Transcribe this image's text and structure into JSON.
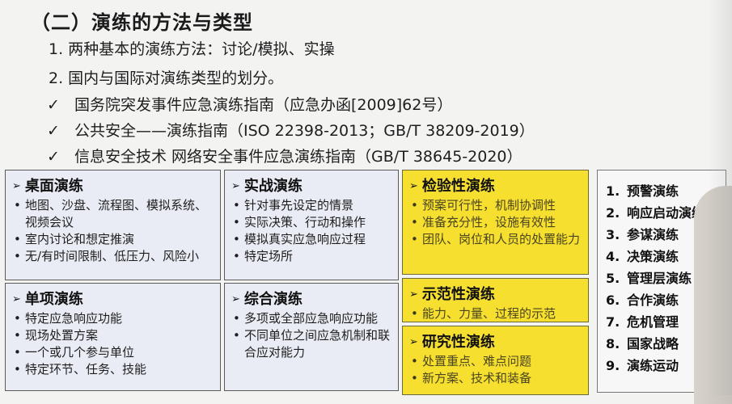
{
  "title": "（二）演练的方法与类型",
  "lines": [
    "1. 两种基本的演练方法：讨论/模拟、实操",
    "2. 国内与国际对演练类型的划分。"
  ],
  "check_mark": "✓",
  "checks": [
    "国务院突发事件应急演练指南（应急办函[2009]62号）",
    "公共安全——演练指南（ISO 22398-2013；GB/T 38209-2019）",
    "信息安全技术 网络安全事件应急演练指南（GB/T 38645-2020）"
  ],
  "arrow": "➢",
  "boxes": {
    "desktop": {
      "title": "桌面演练",
      "items": [
        "地图、沙盘、流程图、模拟系统、视频会议",
        "室内讨论和想定推演",
        "无/有时间限制、低压力、风险小"
      ]
    },
    "actual": {
      "title": "实战演练",
      "items": [
        "针对事先设定的情景",
        "实际决策、行动和操作",
        "模拟真实应急响应过程",
        "特定场所"
      ]
    },
    "verify": {
      "title": "检验性演练",
      "items": [
        "预案可行性，机制协调性",
        "准备充分性，设施有效性",
        "团队、岗位和人员的处置能力"
      ]
    },
    "single": {
      "title": "单项演练",
      "items": [
        "特定应急响应功能",
        "现场处置方案",
        "一个或几个参与单位",
        "特定环节、任务、技能"
      ]
    },
    "combined": {
      "title": "综合演练",
      "items": [
        "多项或全部应急响应功能",
        "不同单位之间应急机制和联合应对能力"
      ]
    },
    "demo": {
      "title": "示范性演练",
      "items": [
        "能力、力量、过程的示范"
      ]
    },
    "research": {
      "title": "研究性演练",
      "items": [
        "处置重点、难点问题",
        "新方案、技术和装备"
      ]
    }
  },
  "numbered": [
    {
      "n": "1.",
      "label": "预警演练"
    },
    {
      "n": "2.",
      "label": "响应启动演练"
    },
    {
      "n": "3.",
      "label": "参谋演练"
    },
    {
      "n": "4.",
      "label": "决策演练"
    },
    {
      "n": "5.",
      "label": "管理层演练"
    },
    {
      "n": "6.",
      "label": "合作演练"
    },
    {
      "n": "7.",
      "label": "危机管理"
    },
    {
      "n": "8.",
      "label": "国家战略"
    },
    {
      "n": "9.",
      "label": "演练运动"
    }
  ]
}
